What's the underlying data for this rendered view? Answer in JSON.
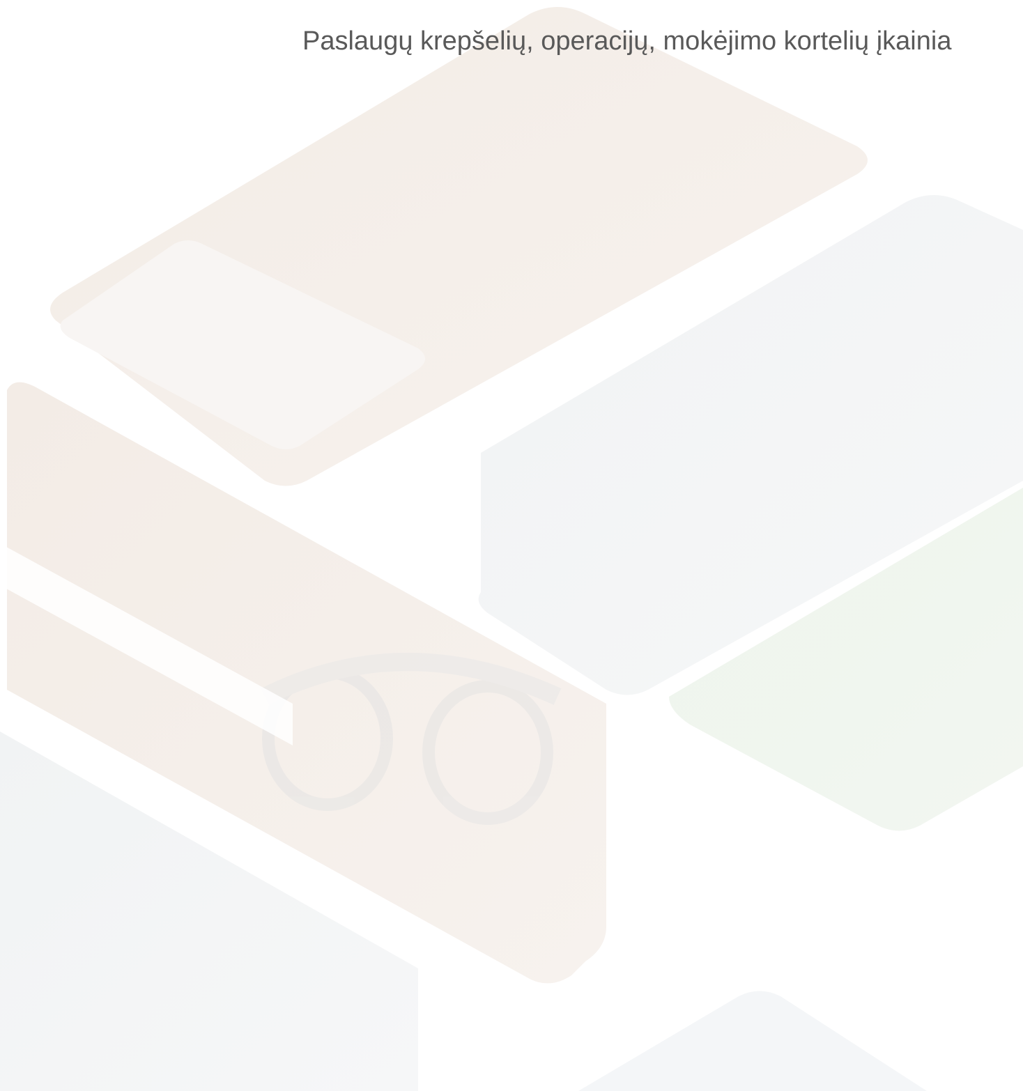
{
  "document": {
    "title": "Paslaugų krepšelių, operacijų, mokėjimo kortelių įkainia"
  },
  "background": {
    "description_icon": "faded-photo-collage",
    "tint": "#ffffff"
  }
}
